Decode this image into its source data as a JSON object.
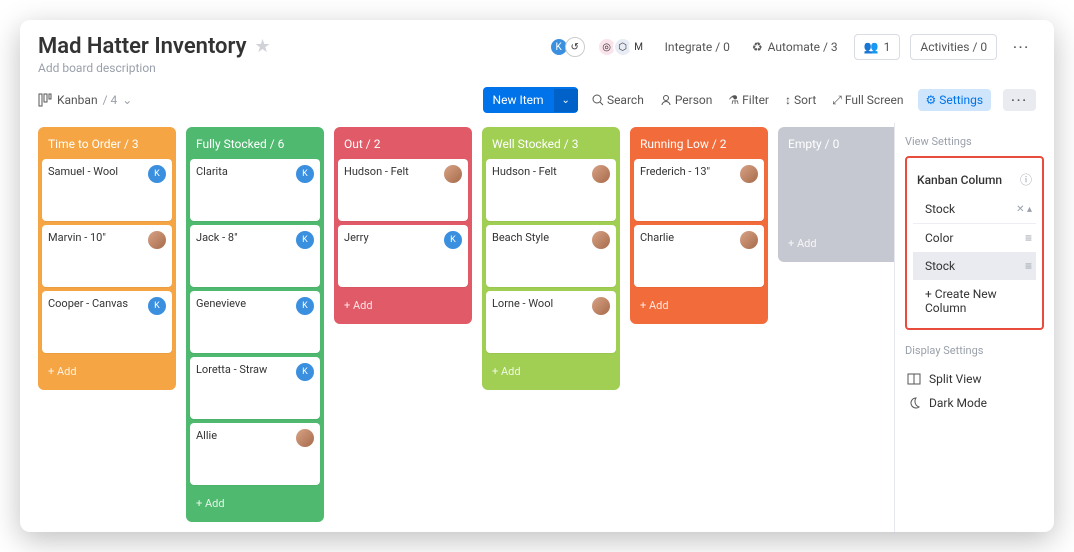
{
  "header": {
    "title": "Mad Hatter Inventory",
    "description_placeholder": "Add board description",
    "integrate_label": "Integrate / 0",
    "automate_label": "Automate / 3",
    "members_label": "1",
    "activities_label": "Activities / 0"
  },
  "toolbar": {
    "view_name": "Kanban",
    "view_count": "/ 4",
    "new_item": "New Item",
    "search": "Search",
    "person": "Person",
    "filter": "Filter",
    "sort": "Sort",
    "full_screen": "Full Screen",
    "settings": "Settings"
  },
  "columns": [
    {
      "title": "Time to Order / 3",
      "color": "orange",
      "add_label": "+ Add",
      "cards": [
        {
          "title": "Samuel - Wool",
          "avatar": "blue",
          "initial": "K"
        },
        {
          "title": "Marvin - 10\"",
          "avatar": "photo",
          "initial": ""
        },
        {
          "title": "Cooper - Canvas",
          "avatar": "blue",
          "initial": "K"
        }
      ]
    },
    {
      "title": "Fully Stocked / 6",
      "color": "green",
      "add_label": "+ Add",
      "cards": [
        {
          "title": "Clarita",
          "avatar": "blue",
          "initial": "K"
        },
        {
          "title": "Jack - 8\"",
          "avatar": "blue",
          "initial": "K"
        },
        {
          "title": "Genevieve",
          "avatar": "blue",
          "initial": "K"
        },
        {
          "title": "Loretta - Straw",
          "avatar": "blue",
          "initial": "K"
        },
        {
          "title": "Allie",
          "avatar": "photo",
          "initial": ""
        }
      ]
    },
    {
      "title": "Out / 2",
      "color": "red",
      "add_label": "+ Add",
      "cards": [
        {
          "title": "Hudson - Felt",
          "avatar": "photo",
          "initial": ""
        },
        {
          "title": "Jerry",
          "avatar": "blue",
          "initial": "K"
        }
      ]
    },
    {
      "title": "Well Stocked / 3",
      "color": "lime",
      "add_label": "+ Add",
      "cards": [
        {
          "title": "Hudson - Felt",
          "avatar": "photo",
          "initial": ""
        },
        {
          "title": "Beach Style",
          "avatar": "photo",
          "initial": ""
        },
        {
          "title": "Lorne - Wool",
          "avatar": "photo",
          "initial": ""
        }
      ]
    },
    {
      "title": "Running Low / 2",
      "color": "deeporange",
      "add_label": "+ Add",
      "cards": [
        {
          "title": "Frederich - 13\"",
          "avatar": "photo",
          "initial": ""
        },
        {
          "title": "Charlie",
          "avatar": "photo",
          "initial": ""
        }
      ]
    },
    {
      "title": "Empty / 0",
      "color": "gray",
      "add_label": "+ Add",
      "cards": []
    }
  ],
  "sidebar": {
    "view_settings_title": "View Settings",
    "kanban_column_label": "Kanban Column",
    "selected_value": "Stock",
    "options": [
      {
        "label": "Color",
        "selected": false
      },
      {
        "label": "Stock",
        "selected": true
      }
    ],
    "create_new_label": "+ Create New Column",
    "display_settings_title": "Display Settings",
    "split_view_label": "Split View",
    "dark_mode_label": "Dark Mode"
  }
}
